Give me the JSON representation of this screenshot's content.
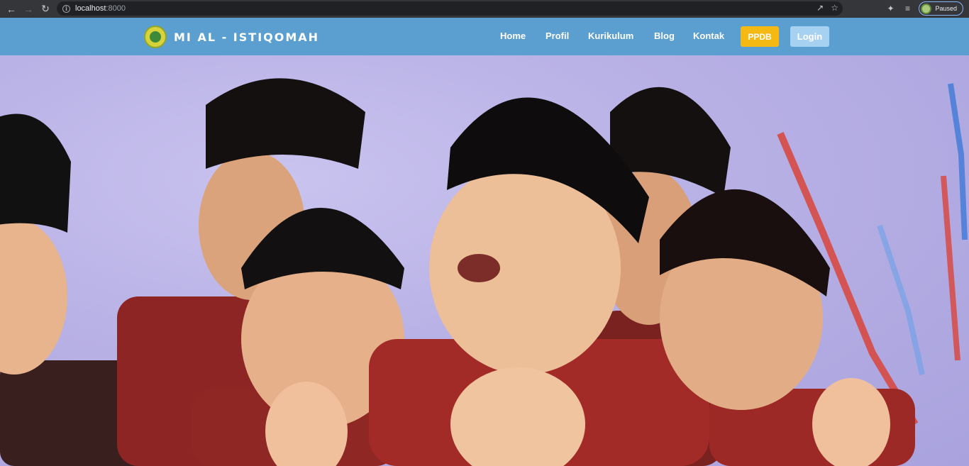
{
  "browser": {
    "url_host": "localhost",
    "url_port": ":8000",
    "profile_status": "Paused"
  },
  "site": {
    "brand": "MI AL - ISTIQOMAH",
    "menu": {
      "home": "Home",
      "profil": "Profil",
      "kurikulum": "Kurikulum",
      "blog": "Blog",
      "kontak": "Kontak"
    },
    "ppdb_label": "PPDB",
    "login_label": "Login"
  },
  "colors": {
    "navbar": "#5b9fd0",
    "ppdb_button": "#f5b914",
    "login_button": "#a7d1f1"
  },
  "hero": {
    "image_description_icon": "photo-students-praying"
  }
}
